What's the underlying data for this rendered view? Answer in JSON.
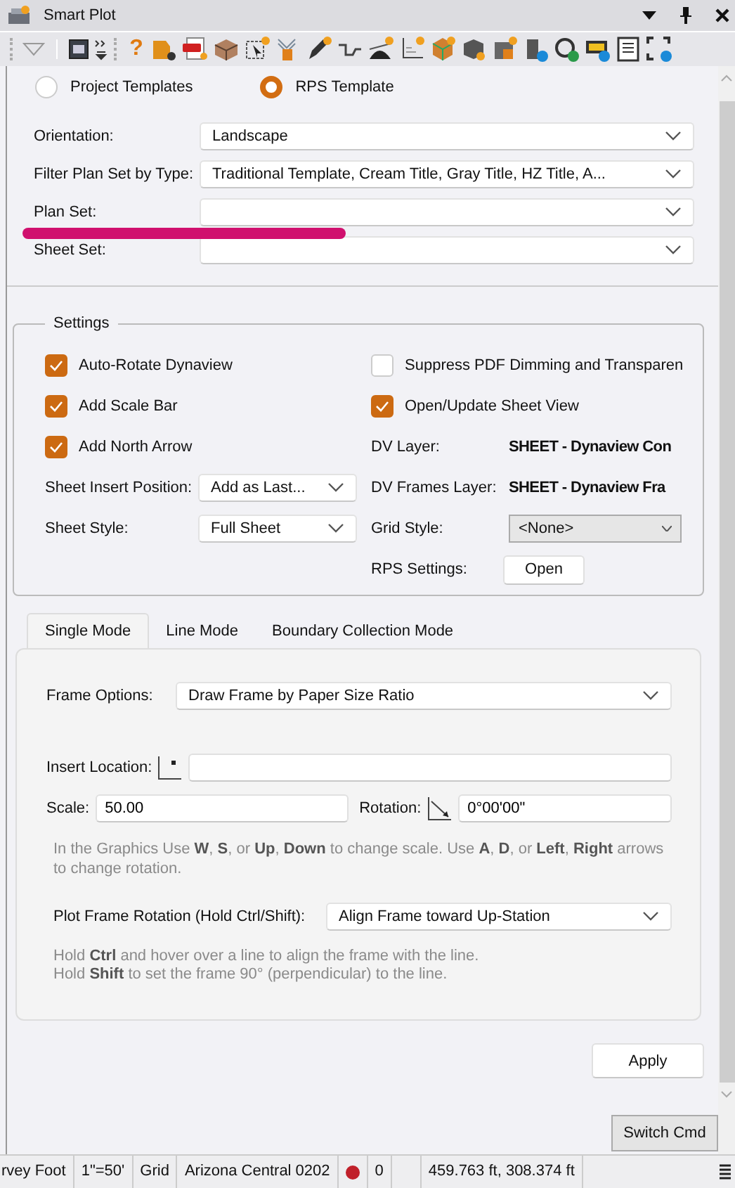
{
  "window": {
    "title": "Smart Plot"
  },
  "toolbar": {
    "help_glyph": "?"
  },
  "template_source": [
    {
      "label": "Project Templates",
      "selected": false
    },
    {
      "label": "RPS Template",
      "selected": true
    }
  ],
  "plan_fields": [
    {
      "label": "Orientation:",
      "value": "Landscape"
    },
    {
      "label": "Filter Plan Set by Type:",
      "value": "Traditional Template, Cream Title, Gray Title, HZ Title, A..."
    },
    {
      "label": "Plan Set:"
    },
    {
      "label": "Sheet Set:"
    }
  ],
  "settings": {
    "title": "Settings",
    "left": [
      {
        "kind": "checkbox",
        "label": "Auto-Rotate Dynaview",
        "checked": true
      },
      {
        "kind": "checkbox",
        "label": "Add Scale Bar",
        "checked": true
      },
      {
        "kind": "checkbox",
        "label": "Add North Arrow",
        "checked": true
      },
      {
        "kind": "dropdown",
        "label": "Sheet Insert Position:",
        "value": "Add as Last..."
      },
      {
        "kind": "dropdown",
        "label": "Sheet Style:",
        "value": "Full Sheet"
      }
    ],
    "right": [
      {
        "kind": "checkbox",
        "label": "Suppress PDF Dimming and Transparen",
        "checked": false
      },
      {
        "kind": "checkbox",
        "label": "Open/Update Sheet View",
        "checked": true
      },
      {
        "kind": "info",
        "label": "DV Layer:",
        "value": "SHEET - Dynaview Con"
      },
      {
        "kind": "info",
        "label": "DV Frames Layer:",
        "value": "SHEET - Dynaview Fra"
      },
      {
        "kind": "combo",
        "label": "Grid Style:",
        "value": "<None>"
      },
      {
        "kind": "button",
        "label": "RPS Settings:",
        "value": "Open"
      }
    ]
  },
  "modes": {
    "tabs": [
      {
        "label": "Single Mode",
        "selected": true
      },
      {
        "label": "Line Mode",
        "selected": false
      },
      {
        "label": "Boundary Collection Mode",
        "selected": false
      }
    ],
    "frame_options": {
      "label": "Frame Options:",
      "value": "Draw Frame by Paper Size Ratio"
    },
    "insert_location": {
      "label": "Insert Location:"
    },
    "scale": {
      "label": "Scale:",
      "value": "50.00"
    },
    "rotation": {
      "label": "Rotation:",
      "value": "0°00'00\""
    },
    "keys_hint": "In the Graphics Use **W**, **S**, or **Up**, **Down** to change scale. Use **A**, **D**, or **Left**, **Right** arrows to change rotation.",
    "plot_frame_rotation": {
      "label": "Plot Frame Rotation (Hold Ctrl/Shift):",
      "value": "Align Frame toward Up-Station"
    },
    "align_hint": [
      "Hold **Ctrl** and hover over a line to align the frame with the line.",
      "Hold **Shift** to set the frame 90° (perpendicular) to the line."
    ]
  },
  "actions": {
    "apply": "Apply",
    "switch": "Switch Cmd"
  },
  "status_bar": [
    {
      "kind": "text",
      "text": "rvey Foot"
    },
    {
      "kind": "text",
      "text": "1\"=50'"
    },
    {
      "kind": "text",
      "text": "Grid"
    },
    {
      "kind": "text",
      "text": "Arizona Central 0202"
    },
    {
      "kind": "dot",
      "color": "#c0202a"
    },
    {
      "kind": "text",
      "text": "0"
    },
    {
      "kind": "blank"
    },
    {
      "kind": "text",
      "text": "459.763 ft, 308.374 ft"
    }
  ]
}
